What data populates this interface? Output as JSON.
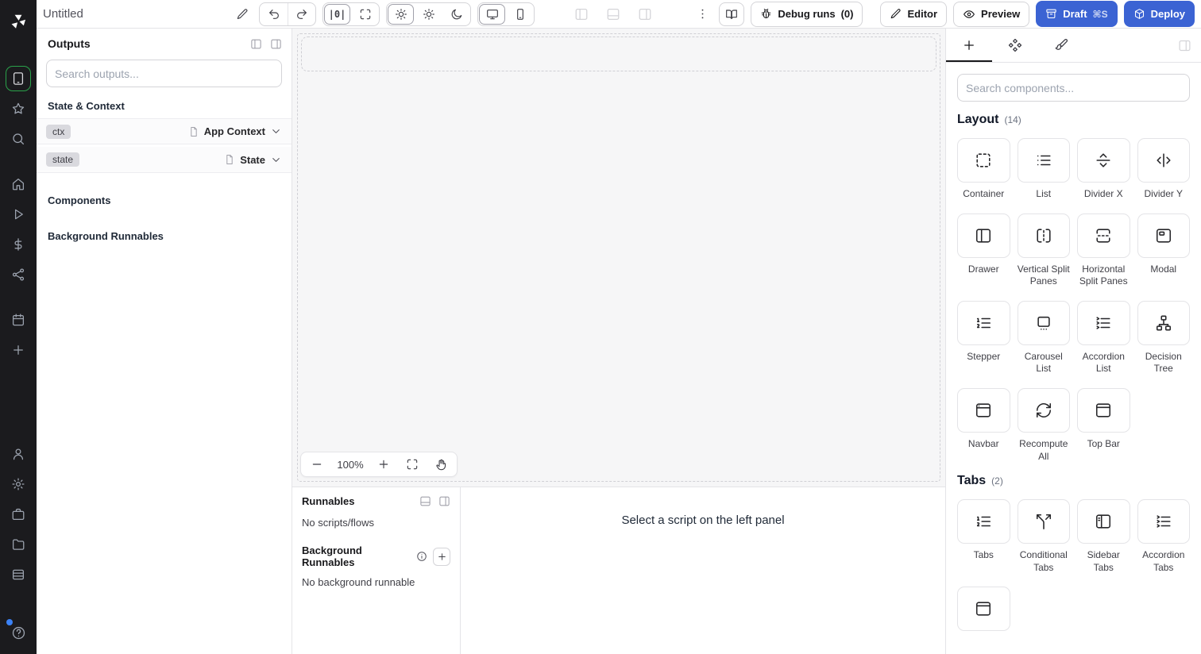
{
  "colors": {
    "primary_button": "#3b63d3",
    "active_nav_green": "#2aa24a"
  },
  "topbar": {
    "title": "Untitled",
    "scale_glyph": "|0|",
    "debug_runs_label": "Debug runs",
    "debug_runs_count": "(0)",
    "editor_label": "Editor",
    "preview_label": "Preview",
    "draft_label": "Draft",
    "draft_shortcut": "⌘S",
    "deploy_label": "Deploy"
  },
  "left_panel": {
    "outputs_title": "Outputs",
    "search_placeholder": "Search outputs...",
    "state_context_title": "State & Context",
    "ctx_badge": "ctx",
    "ctx_value": "App Context",
    "state_badge": "state",
    "state_value": "State",
    "components_title": "Components",
    "background_runnables_title": "Background Runnables"
  },
  "canvas": {
    "zoom_level": "100%"
  },
  "runnables": {
    "title": "Runnables",
    "no_scripts": "No scripts/flows",
    "background_title": "Background Runnables",
    "no_background": "No background runnable",
    "empty_hint": "Select a script on the left panel"
  },
  "right_panel": {
    "search_placeholder": "Search components...",
    "sections": [
      {
        "title": "Layout",
        "count": "(14)",
        "items": [
          {
            "label": "Container",
            "icon": "container"
          },
          {
            "label": "List",
            "icon": "list"
          },
          {
            "label": "Divider X",
            "icon": "divider-x"
          },
          {
            "label": "Divider Y",
            "icon": "divider-y"
          },
          {
            "label": "Drawer",
            "icon": "drawer"
          },
          {
            "label": "Vertical Split Panes",
            "icon": "v-split"
          },
          {
            "label": "Horizontal Split Panes",
            "icon": "h-split"
          },
          {
            "label": "Modal",
            "icon": "modal"
          },
          {
            "label": "Stepper",
            "icon": "stepper"
          },
          {
            "label": "Carousel List",
            "icon": "carousel"
          },
          {
            "label": "Accordion List",
            "icon": "accordion"
          },
          {
            "label": "Decision Tree",
            "icon": "tree"
          },
          {
            "label": "Navbar",
            "icon": "navbar"
          },
          {
            "label": "Recompute All",
            "icon": "recompute"
          },
          {
            "label": "Top Bar",
            "icon": "topbar"
          }
        ]
      },
      {
        "title": "Tabs",
        "count": "(2)",
        "items": [
          {
            "label": "Tabs",
            "icon": "tabs"
          },
          {
            "label": "Conditional Tabs",
            "icon": "split"
          },
          {
            "label": "Sidebar Tabs",
            "icon": "sidebar"
          },
          {
            "label": "Accordion Tabs",
            "icon": "accordion"
          },
          {
            "label": "",
            "icon": "topbar"
          }
        ]
      }
    ]
  }
}
